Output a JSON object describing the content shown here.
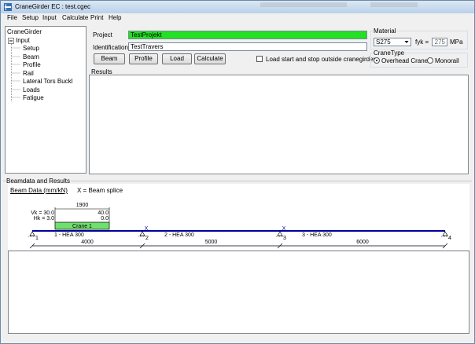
{
  "window": {
    "title": "CraneGirder EC : test.cgec"
  },
  "menu": [
    "File",
    "Setup",
    "Input",
    "Calculate",
    "Print",
    "Help"
  ],
  "tree": {
    "root": "CraneGirder",
    "node": "Input",
    "items": [
      "Setup",
      "Beam",
      "Profile",
      "Rail",
      "Lateral Tors Buckl",
      "Loads",
      "Fatigue"
    ]
  },
  "form": {
    "project_label": "Project",
    "project_value": "TestProjekt",
    "identification_label": "Identification:",
    "identification_value": "TestTravers",
    "buttons": [
      "Beam",
      "Profile",
      "Load",
      "Calculate"
    ],
    "checkbox_label": "Load start and stop outside cranegirder",
    "checkbox_checked": false
  },
  "material": {
    "label": "Material",
    "grade": "S275",
    "fyk_label": "fyk =",
    "fyk_value": "275",
    "unit": "MPa"
  },
  "crane_type": {
    "label": "CraneType",
    "options": [
      "Overhead Crane",
      "Monorail"
    ],
    "selected": "Overhead Crane"
  },
  "results": {
    "label": "Results"
  },
  "beamdata": {
    "group_label": "Beamdata and Results",
    "title": "Beam Data (mm/kN)",
    "legend": "X = Beam splice",
    "colors": {
      "beam": "#0000a0",
      "crane": "#6ee06e",
      "accent": "#22e022"
    },
    "crane": {
      "width": "1900",
      "va": "Vk = 30.0",
      "hk": "Hk = 3.0",
      "right_top": "40.0",
      "right_bot": "0.0",
      "label": "Crane 1"
    },
    "supports": [
      {
        "num": "1",
        "pos": 0
      },
      {
        "num": "2",
        "pos": 4000
      },
      {
        "num": "3",
        "pos": 9000
      },
      {
        "num": "4",
        "pos": 15000
      }
    ],
    "spans": [
      {
        "profile": "1 - HEA 300",
        "length": "4000",
        "start": 0,
        "end": 4000
      },
      {
        "profile": "2 - HEA 300",
        "length": "5000",
        "start": 4000,
        "end": 9000
      },
      {
        "profile": "3 - HEA 300",
        "length": "6000",
        "start": 9000,
        "end": 15000
      }
    ],
    "splice_positions": [
      4000,
      9000
    ],
    "total_length": 15000
  }
}
